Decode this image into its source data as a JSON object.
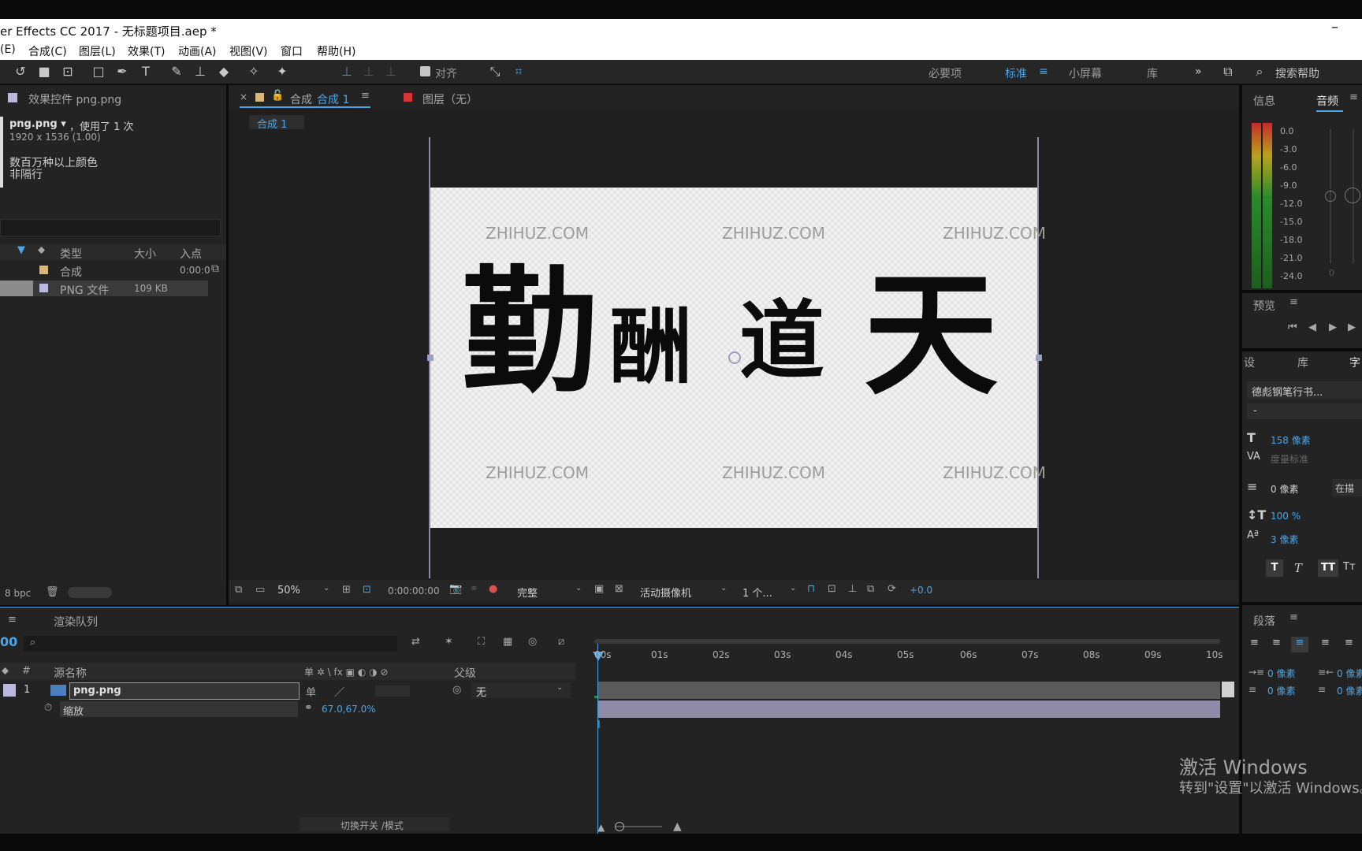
{
  "window": {
    "title": "er Effects CC 2017 - 无标题项目.aep *",
    "minimize": "–"
  },
  "menu": [
    "(E)",
    "合成(C)",
    "图层(L)",
    "效果(T)",
    "动画(A)",
    "视图(V)",
    "窗口",
    "帮助(H)"
  ],
  "toolbar": {
    "snap_label": "对齐",
    "workspaces": [
      "必要项",
      "标准",
      "小屏幕",
      "库"
    ],
    "active_workspace": "标准",
    "search_placeholder": "搜索帮助",
    "more": "»"
  },
  "project": {
    "panel_title": "效果控件 png.png",
    "file_name": "png.png ▾",
    "used": "，使用了 1 次",
    "dimensions": "1920 x 1536 (1.00)",
    "color_info": "数百万种以上颜色",
    "interlace": "非隔行",
    "columns": [
      "类型",
      "大小",
      "入点"
    ],
    "rows": [
      {
        "type": "合成",
        "size": "",
        "in": "0:00:0"
      },
      {
        "type": "PNG 文件",
        "size": "109 KB",
        "in": ""
      }
    ],
    "bpc": "8 bpc"
  },
  "comp": {
    "tab_prefix": "合成",
    "tab_name": "合成 1",
    "layer_tab": "图层（无）",
    "breadcrumb": "合成 1",
    "artwork_text": [
      "勤",
      "酬",
      "道",
      "天"
    ],
    "watermark": "ZHIHUZ.COM",
    "footer": {
      "zoom": "50%",
      "timecode": "0:00:00:00",
      "quality": "完整",
      "camera": "活动摄像机",
      "views": "1 个...",
      "exposure": "+0.0"
    }
  },
  "right": {
    "tabs_top": [
      "信息",
      "音频"
    ],
    "active_top": "音频",
    "meter_labels": [
      "0.0",
      "-3.0",
      "-6.0",
      "-9.0",
      "-12.0",
      "-15.0",
      "-18.0",
      "-21.0",
      "-24.0"
    ],
    "meter_right_zero": "0",
    "preview_title": "预览",
    "tabs_mid": [
      "设",
      "库",
      "字"
    ],
    "font_name": "德彪钢笔行书...",
    "font_style": "-",
    "font_size": "158 像素",
    "kerning": "度量标准",
    "leading": "0 像素",
    "stroke": "在描",
    "vscale": "100 %",
    "baseline": "3 像素",
    "para_title": "段落",
    "indent_left": "0 像素",
    "indent_right": "0 像素",
    "space_before": "0 像素",
    "space_after": "0 像素"
  },
  "timeline": {
    "panel_tab": "渲染队列",
    "timecode_fragment": "00",
    "search_placeholder": "",
    "col_num": "#",
    "col_source": "源名称",
    "col_switches": "单 ✲ \\ fx ▣ ◐ ◑ ⊘",
    "col_parent": "父级",
    "layer": {
      "index": "1",
      "name": "png.png",
      "parent": "无"
    },
    "property": {
      "name": "缩放",
      "value": "67.0,67.0%"
    },
    "ruler": [
      "00s",
      "01s",
      "02s",
      "03s",
      "04s",
      "05s",
      "06s",
      "07s",
      "08s",
      "09s",
      "10s"
    ],
    "footer_label": "切换开关 /模式"
  },
  "activation": {
    "line1": "激活 Windows",
    "line2": "转到\"设置\"以激活 Windows。"
  },
  "colors": {
    "accent": "#4aa6e8",
    "panel": "#232323",
    "layer_bar": "#8f8aa6"
  }
}
